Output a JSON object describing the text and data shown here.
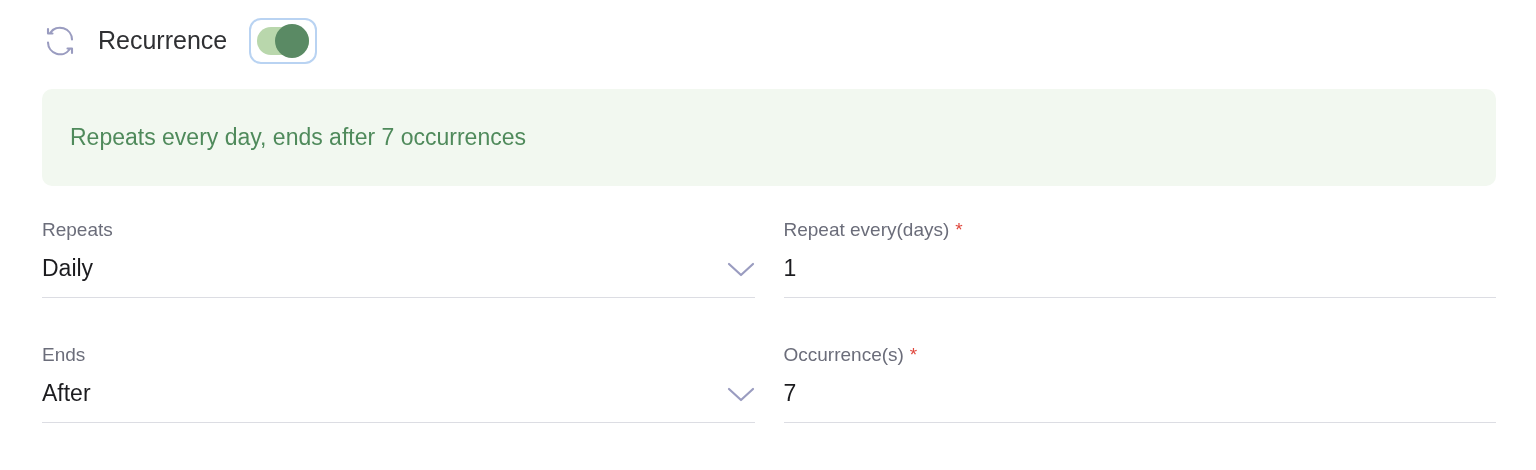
{
  "header": {
    "title": "Recurrence",
    "enabled": true
  },
  "summary": "Repeats every day, ends after 7 occurrences",
  "fields": [
    {
      "label": "Repeats",
      "value": "Daily",
      "kind": "select"
    },
    {
      "label": "Repeat every(days)",
      "required_mark": "*",
      "value": "1",
      "kind": "input"
    },
    {
      "label": "Ends",
      "value": "After",
      "kind": "select"
    },
    {
      "label": "Occurrence(s)",
      "required_mark": "*",
      "value": "7",
      "kind": "input"
    }
  ]
}
